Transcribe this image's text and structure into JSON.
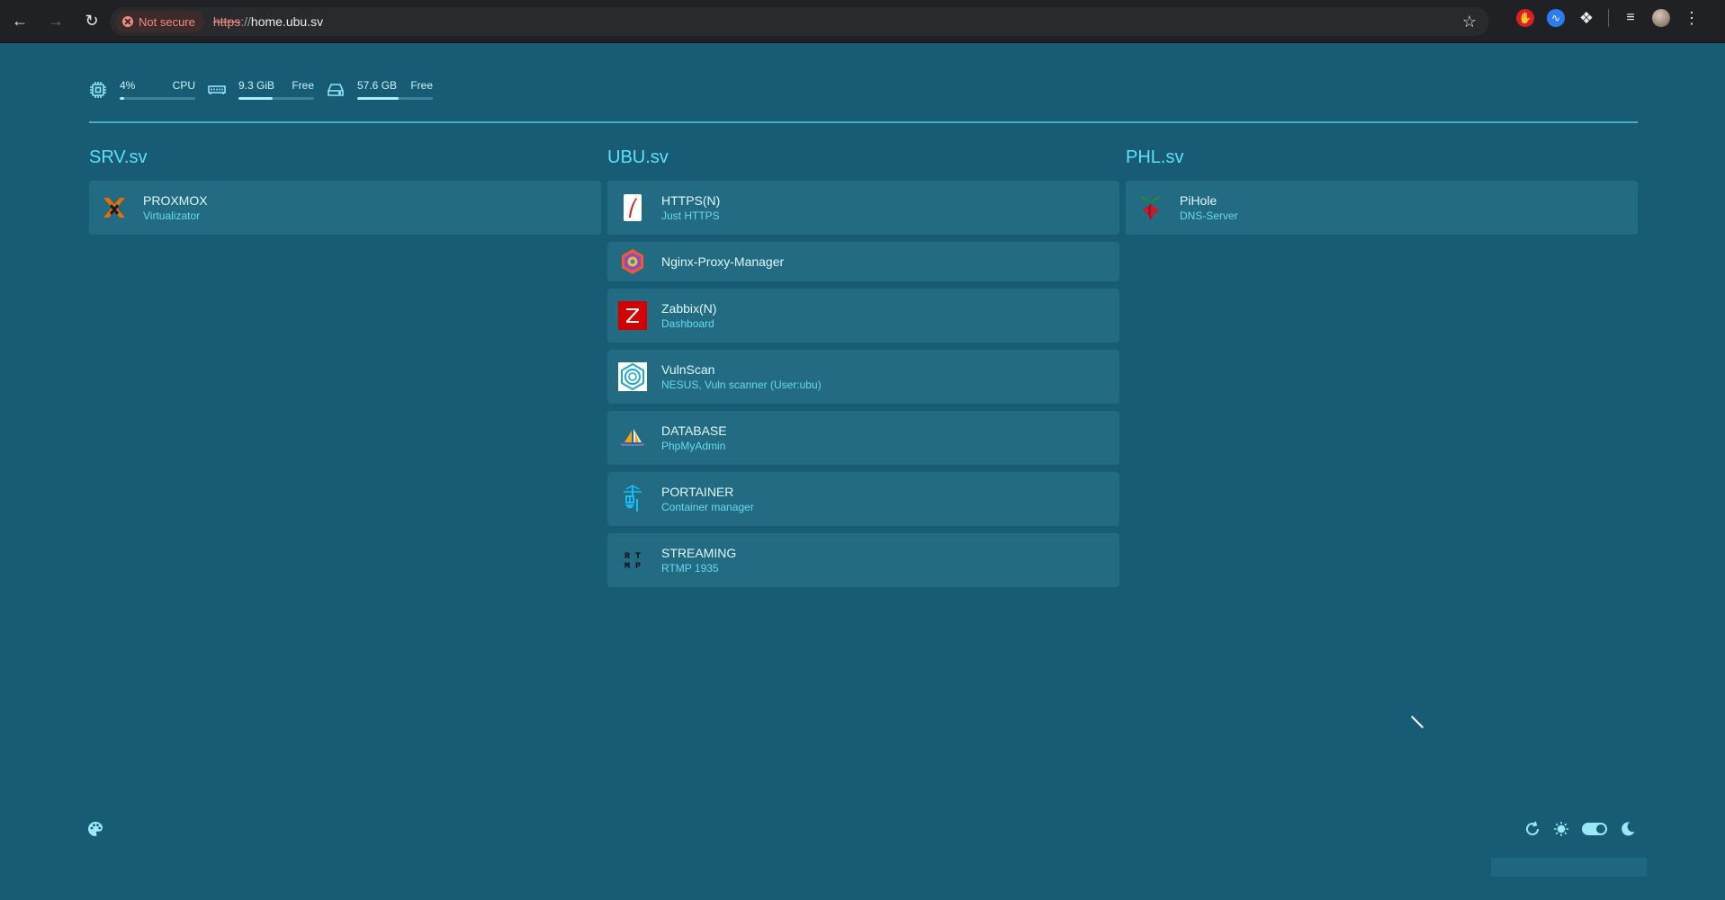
{
  "browser": {
    "security_label": "Not secure",
    "url_scheme": "https",
    "url_separator": "://",
    "url_host": "home.ubu.sv"
  },
  "stats": {
    "cpu": {
      "value": "4%",
      "label": "CPU",
      "fraction": 0.04
    },
    "memory": {
      "value": "9.3 GiB",
      "label": "Free",
      "fraction": 0.45
    },
    "disk": {
      "value": "57.6 GB",
      "label": "Free",
      "fraction": 0.55
    }
  },
  "columns": [
    {
      "title": "SRV.sv",
      "items": [
        {
          "title": "PROXMOX",
          "subtitle": "Virtualizator",
          "icon": "proxmox-icon"
        }
      ]
    },
    {
      "title": "UBU.sv",
      "items": [
        {
          "title": "HTTPS(N)",
          "subtitle": "Just HTTPS",
          "icon": "feather-icon"
        },
        {
          "title": "Nginx-Proxy-Manager",
          "subtitle": "",
          "icon": "nginx-proxy-manager-icon"
        },
        {
          "title": "Zabbix(N)",
          "subtitle": "Dashboard",
          "icon": "zabbix-icon"
        },
        {
          "title": "VulnScan",
          "subtitle": "NESUS, Vuln scanner (User:ubu)",
          "icon": "vulnscan-icon"
        },
        {
          "title": "DATABASE",
          "subtitle": "PhpMyAdmin",
          "icon": "phpmyadmin-icon"
        },
        {
          "title": "PORTAINER",
          "subtitle": "Container manager",
          "icon": "portainer-icon"
        },
        {
          "title": "STREAMING",
          "subtitle": "RTMP 1935",
          "icon": "rtmp-icon",
          "icon_text": "RTMP"
        }
      ]
    },
    {
      "title": "PHL.sv",
      "items": [
        {
          "title": "PiHole",
          "subtitle": "DNS-Server",
          "icon": "pihole-icon"
        }
      ]
    }
  ],
  "colors": {
    "background": "#175b75",
    "card": "#236b83",
    "accent": "#5ee0f7",
    "subtitle": "#66d9f0"
  }
}
